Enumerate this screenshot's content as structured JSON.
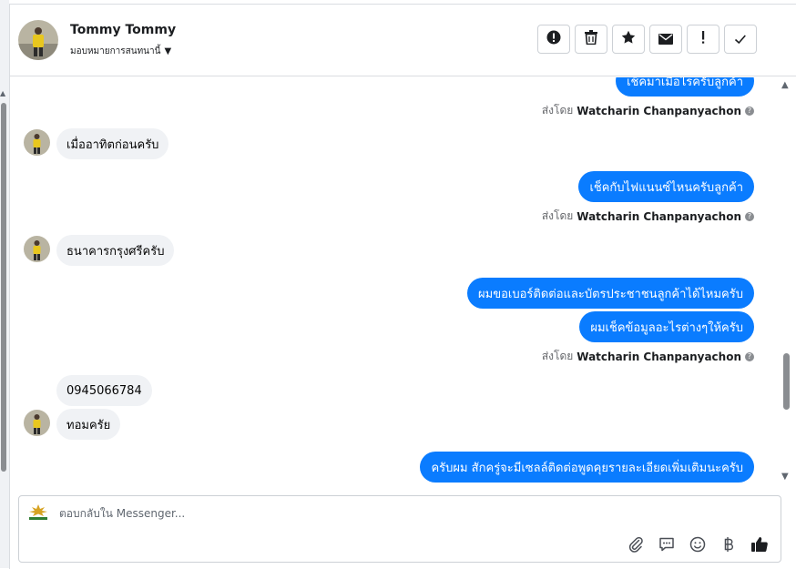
{
  "header": {
    "contact_name": "Tommy Tommy",
    "assign_label": "มอบหมายการสนทนานี้"
  },
  "toolbar": [
    {
      "name": "spam-button",
      "icon": "exclamation-circle-icon"
    },
    {
      "name": "delete-button",
      "icon": "trash-icon"
    },
    {
      "name": "star-button",
      "icon": "star-icon"
    },
    {
      "name": "mark-unread-button",
      "icon": "envelope-icon"
    },
    {
      "name": "flag-button",
      "icon": "exclamation-icon"
    },
    {
      "name": "done-button",
      "icon": "checkmark-icon"
    }
  ],
  "messages": {
    "out_1": "เช็คมาเมื่อไรครับลูกค้า",
    "sent_by_prefix_1": "ส่งโดย",
    "sent_by_name_1": "Watcharin Chanpanyachon",
    "in_1": "เมื่ออาทิตก่อนครับ",
    "out_2": "เช็คกับไฟแนนซ์ไหนครับลูกค้า",
    "sent_by_prefix_2": "ส่งโดย",
    "sent_by_name_2": "Watcharin Chanpanyachon",
    "in_2": "ธนาคารกรุงศรีครับ",
    "out_3": "ผมขอเบอร์ติดต่อและบัตรประชาชนลูกค้าได้ไหมครับ",
    "out_4": "ผมเช็คข้อมูลอะไรต่างๆให้ครับ",
    "sent_by_prefix_3": "ส่งโดย",
    "sent_by_name_3": "Watcharin Chanpanyachon",
    "in_3": "0945066784",
    "in_4": "ทอมครัย",
    "out_5": "ครับผม สักครู่จะมีเซลล์ติดต่อพูดคุยรายละเอียดเพิ่มเติมนะครับ"
  },
  "composer": {
    "placeholder": "ตอบกลับใน Messenger...",
    "value": "",
    "actions": [
      "paperclip-icon",
      "saved-reply-icon",
      "emoji-icon",
      "baht-icon",
      "thumbs-up-icon"
    ]
  },
  "colors": {
    "outgoing_bubble": "#0a7cff",
    "incoming_bubble": "#f0f2f5",
    "brand_gold": "#d7a323"
  }
}
